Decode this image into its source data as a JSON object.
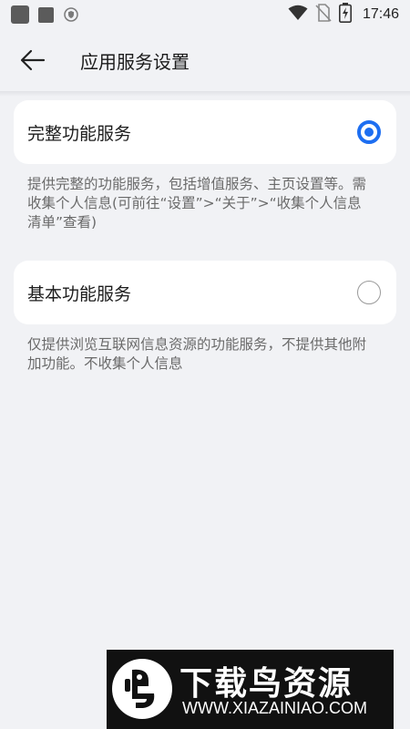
{
  "status_bar": {
    "time": "17:46",
    "icons": [
      "app-notification-icon",
      "app-notification-icon",
      "shield-icon",
      "wifi-icon",
      "no-sim-icon",
      "battery-charging-icon"
    ]
  },
  "header": {
    "title": "应用服务设置",
    "back_icon": "arrow-left-icon"
  },
  "options": [
    {
      "title": "完整功能服务",
      "selected": true,
      "description": "提供完整的功能服务，包括增值服务、主页设置等。需收集个人信息(可前往“设置”>“关于”>“收集个人信息清单”查看)"
    },
    {
      "title": "基本功能服务",
      "selected": false,
      "description": "仅提供浏览互联网信息资源的功能服务，不提供其他附加功能。不收集个人信息"
    }
  ],
  "watermark": {
    "main": "下载鸟资源",
    "url": "WWW.XIAZAINIAO.COM"
  },
  "colors": {
    "accent": "#1d6ef1",
    "background": "#f1f2f5",
    "card": "#ffffff",
    "secondary_text": "#6a6a6a"
  }
}
